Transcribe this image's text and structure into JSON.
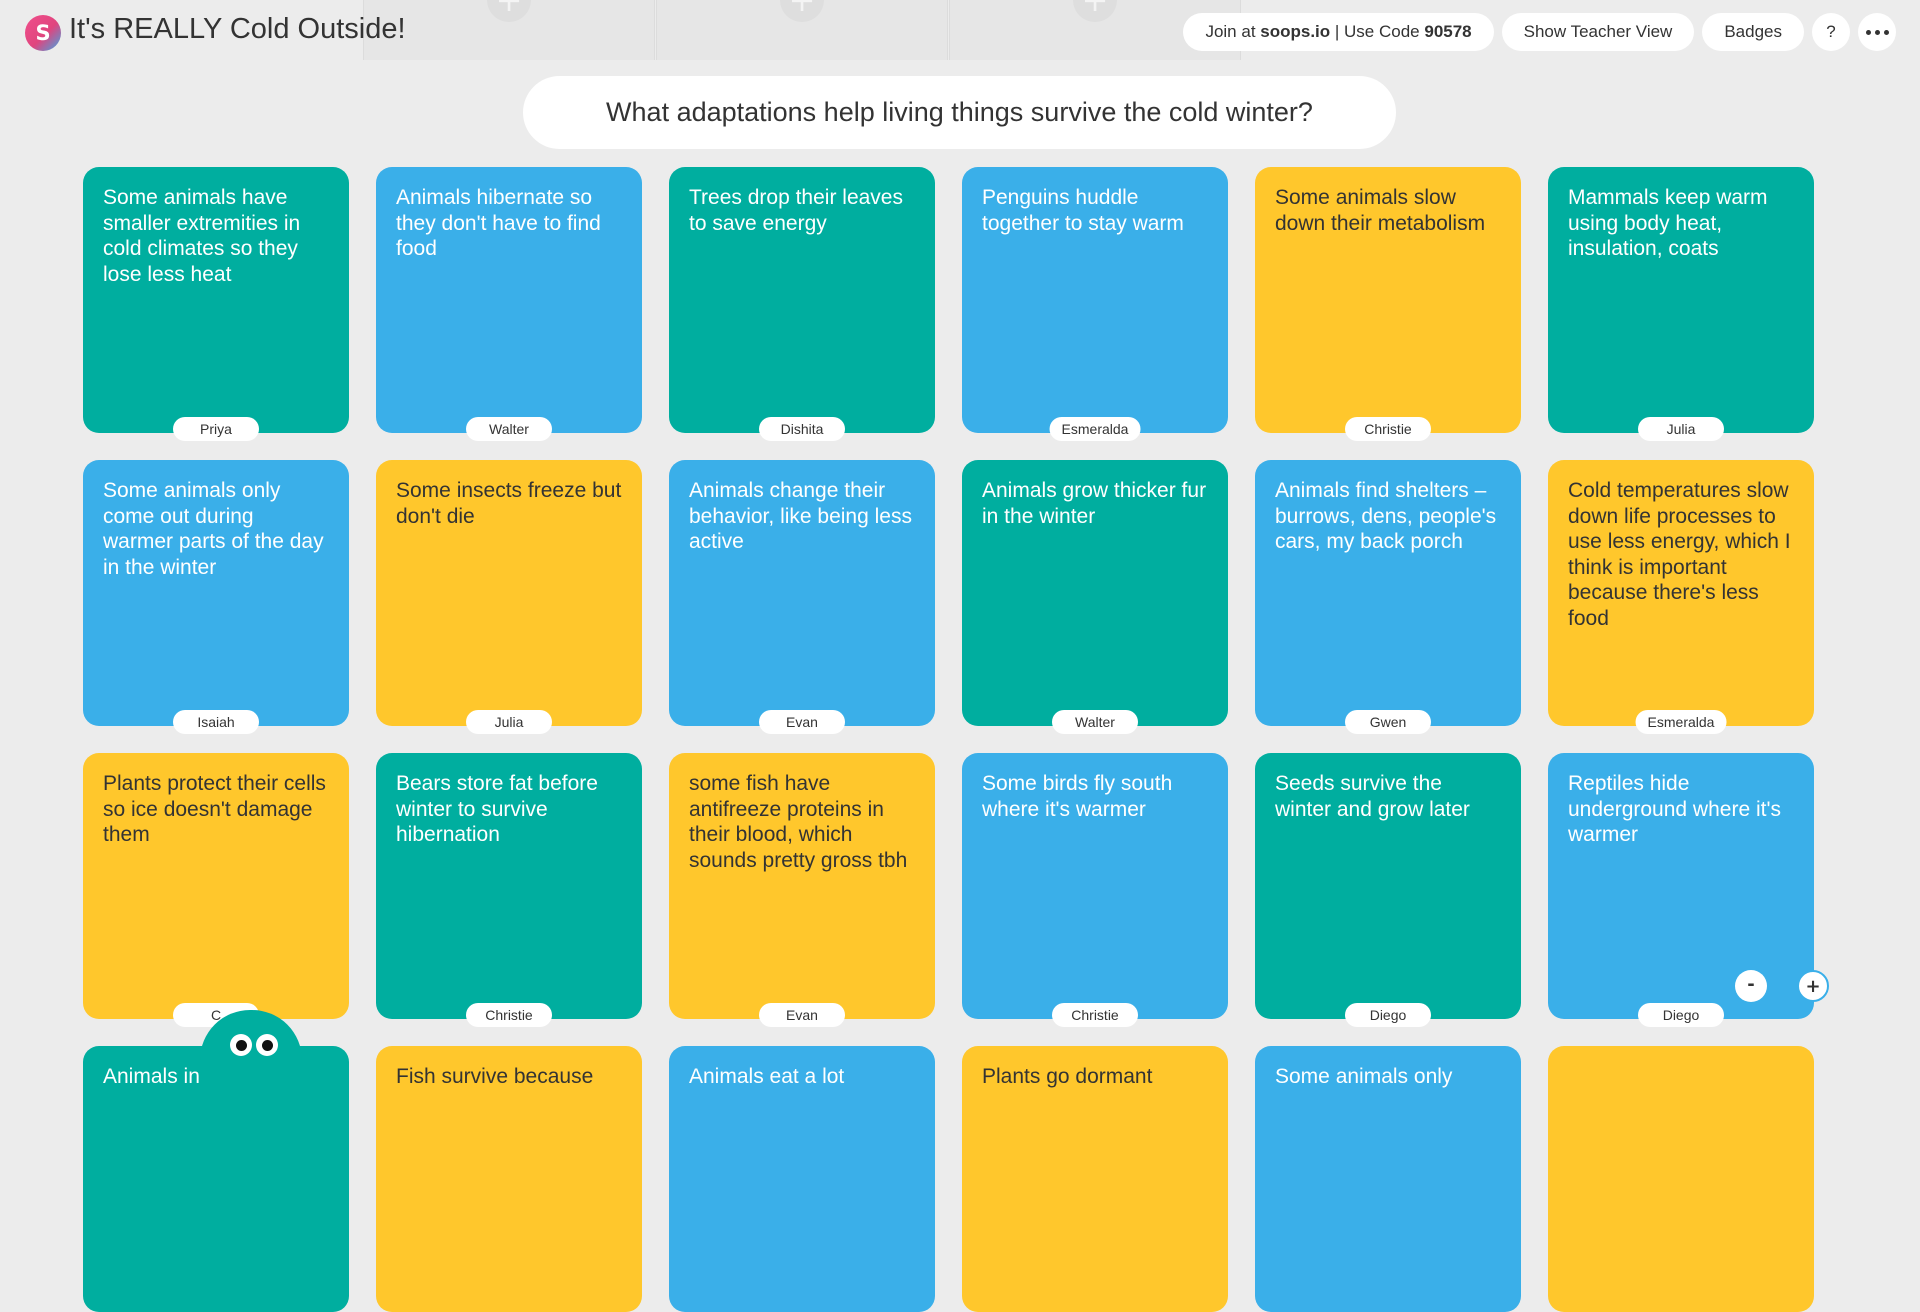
{
  "app": {
    "logo_letter": "S",
    "title": "It's REALLY Cold Outside!"
  },
  "header": {
    "join_prefix": "Join at ",
    "join_site": "soops.io",
    "code_prefix": " | Use Code ",
    "code": "90578",
    "teacher_view_label": "Show Teacher View",
    "badges_label": "Badges",
    "help_label": "?"
  },
  "question": "What adaptations help living things survive the cold winter?",
  "colors": {
    "teal": "#00ae9f",
    "blue": "#3aafe9",
    "yellow": "#ffc72c",
    "background": "#ececec"
  },
  "cards": [
    {
      "text": "Some animals have smaller extremities in cold climates so they lose less heat",
      "author": "Priya",
      "color": "teal"
    },
    {
      "text": "Animals hibernate so they don't have to find food",
      "author": "Walter",
      "color": "blue"
    },
    {
      "text": "Trees drop their leaves to save energy",
      "author": "Dishita",
      "color": "teal"
    },
    {
      "text": "Penguins huddle together to stay warm",
      "author": "Esmeralda",
      "color": "blue"
    },
    {
      "text": "Some animals slow down their metabolism",
      "author": "Christie",
      "color": "yellow"
    },
    {
      "text": "Mammals keep warm using body heat, insulation, coats",
      "author": "Julia",
      "color": "teal"
    },
    {
      "text": "Some animals only come out during warmer parts of the day in the winter",
      "author": "Isaiah",
      "color": "blue"
    },
    {
      "text": "Some insects freeze but don't die",
      "author": "Julia",
      "color": "yellow"
    },
    {
      "text": "Animals change their behavior, like being less active",
      "author": "Evan",
      "color": "blue"
    },
    {
      "text": "Animals grow thicker fur in the winter",
      "author": "Walter",
      "color": "teal"
    },
    {
      "text": "Animals find shelters – burrows, dens, people's cars, my back porch",
      "author": "Gwen",
      "color": "blue"
    },
    {
      "text": "Cold temperatures slow down life processes to use less energy, which I think is important because there's less food",
      "author": "Esmeralda",
      "color": "yellow"
    },
    {
      "text": "Plants protect their cells so ice doesn't damage them",
      "author": "C",
      "color": "yellow"
    },
    {
      "text": "Bears store fat before winter to survive hibernation",
      "author": "Christie",
      "color": "teal"
    },
    {
      "text": "some fish have antifreeze proteins in their blood, which sounds pretty gross tbh",
      "author": "Evan",
      "color": "yellow"
    },
    {
      "text": "Some birds fly south where it's warmer",
      "author": "Christie",
      "color": "blue"
    },
    {
      "text": "Seeds survive the winter and grow later",
      "author": "Diego",
      "color": "teal"
    },
    {
      "text": "Reptiles hide underground where it's warmer",
      "author": "Diego",
      "color": "blue"
    },
    {
      "text": "Animals in          es",
      "author": "",
      "color": "teal"
    },
    {
      "text": "Fish survive because",
      "author": "",
      "color": "yellow"
    },
    {
      "text": "Animals eat a lot",
      "author": "",
      "color": "blue"
    },
    {
      "text": "Plants go dormant",
      "author": "",
      "color": "yellow"
    },
    {
      "text": "Some animals only",
      "author": "",
      "color": "blue"
    },
    {
      "text": "",
      "author": "",
      "color": "yellow"
    }
  ],
  "zoom": {
    "minus_label": "-",
    "plus_label": "+"
  }
}
